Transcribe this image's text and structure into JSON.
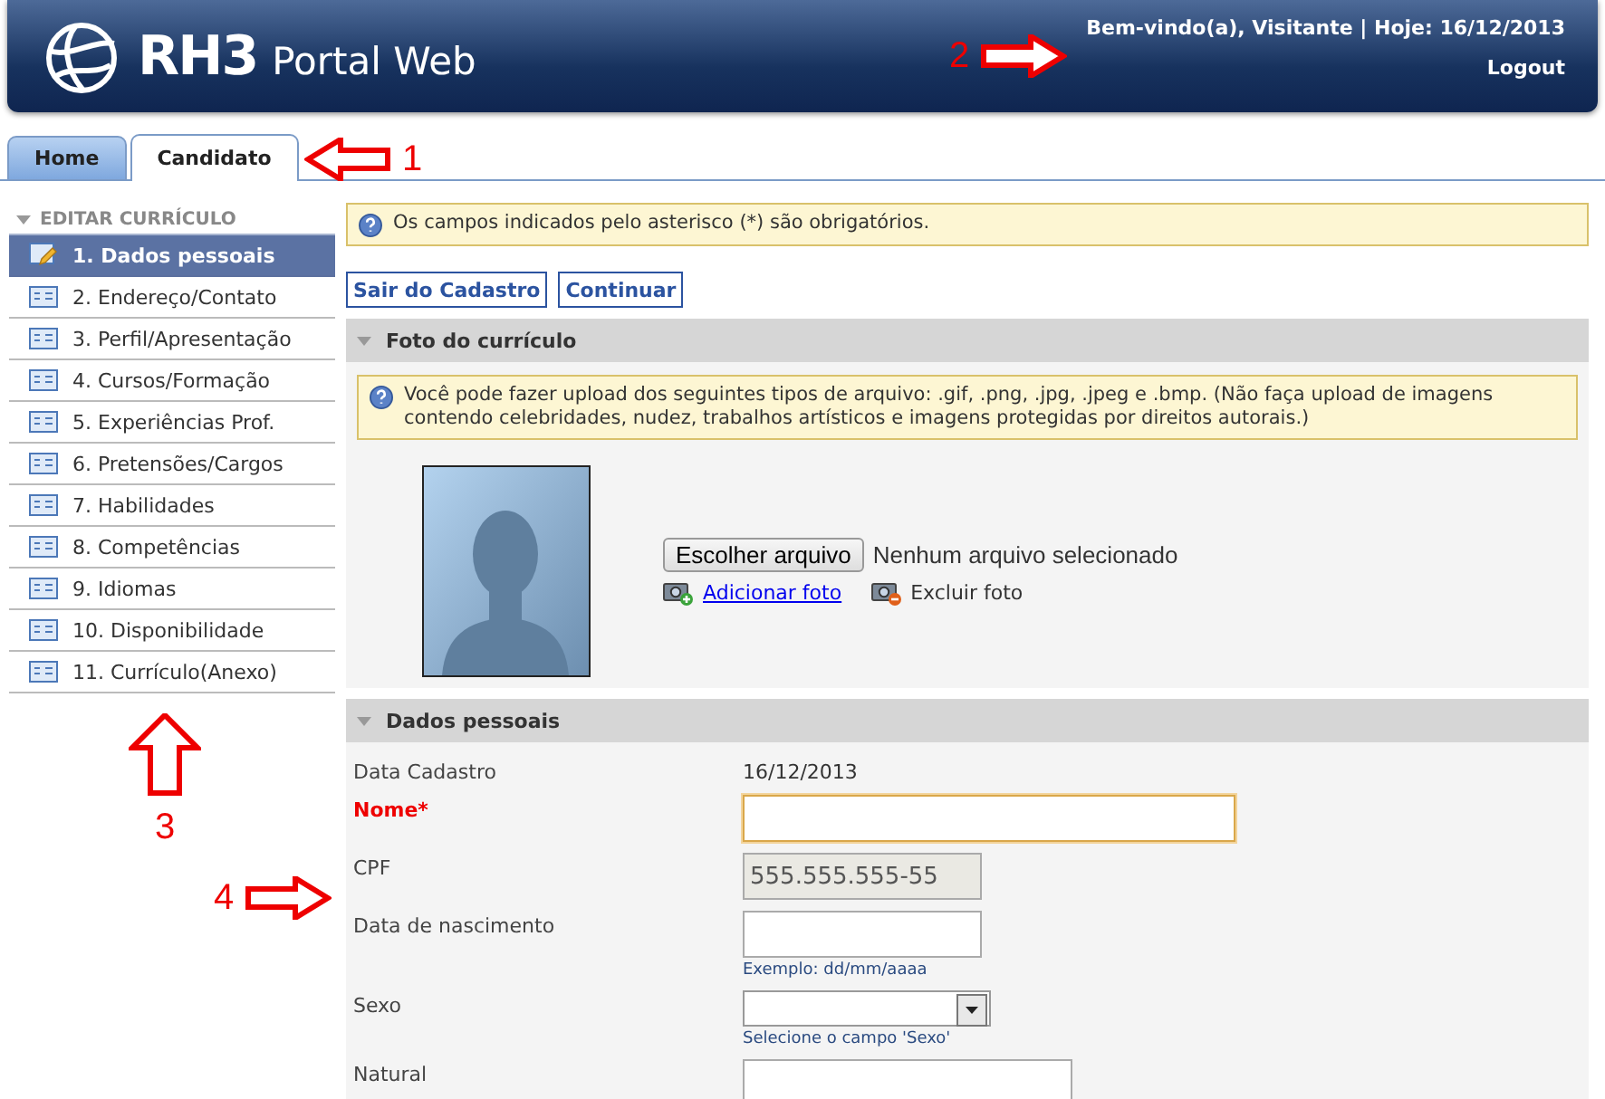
{
  "header": {
    "logo": "RH3",
    "product": "Portal Web",
    "welcome": "Bem-vindo(a), Visitante | Hoje: 16/12/2013",
    "logout": "Logout"
  },
  "tabs": [
    {
      "label": "Home",
      "selected": false
    },
    {
      "label": "Candidato",
      "selected": true
    }
  ],
  "sidebar": {
    "title": "EDITAR CURRÍCULO",
    "items": [
      {
        "label": "1. Dados pessoais",
        "selected": true
      },
      {
        "label": "2. Endereço/Contato",
        "selected": false
      },
      {
        "label": "3. Perfil/Apresentação",
        "selected": false
      },
      {
        "label": "4. Cursos/Formação",
        "selected": false
      },
      {
        "label": "5. Experiências Prof.",
        "selected": false
      },
      {
        "label": "6. Pretensões/Cargos",
        "selected": false
      },
      {
        "label": "7. Habilidades",
        "selected": false
      },
      {
        "label": "8. Competências",
        "selected": false
      },
      {
        "label": "9. Idiomas",
        "selected": false
      },
      {
        "label": "10. Disponibilidade",
        "selected": false
      },
      {
        "label": "11. Currículo(Anexo)",
        "selected": false
      }
    ]
  },
  "notice": "Os campos indicados pelo asterisco (*) são obrigatórios.",
  "buttons": [
    "Sair do Cadastro",
    "Continuar"
  ],
  "photo_section": {
    "title": "Foto do currículo",
    "notice": "Você pode fazer upload dos seguintes tipos de arquivo: .gif, .png, .jpg, .jpeg e .bmp. (Não faça upload de imagens contendo celebridades, nudez, trabalhos artísticos e imagens protegidas por direitos autorais.)",
    "choose_button": "Escolher arquivo",
    "no_file": "Nenhum arquivo selecionado",
    "add_photo": "Adicionar foto",
    "remove_photo": "Excluir foto"
  },
  "personal_section": {
    "title": "Dados pessoais",
    "fields": [
      {
        "label": "Data Cadastro",
        "kind": "text",
        "value": "16/12/2013",
        "required": false
      },
      {
        "label": "Nome*",
        "kind": "wide",
        "required": true,
        "focused": true
      },
      {
        "label": "CPF",
        "kind": "input",
        "value": "555.555.555-55",
        "disabled": true,
        "required": false
      },
      {
        "label": "Data de nascimento",
        "kind": "input",
        "hint": "Exemplo: dd/mm/aaaa",
        "required": false
      },
      {
        "label": "Sexo",
        "kind": "select",
        "hint": "Selecione o campo 'Sexo'",
        "required": false
      },
      {
        "label": "Natural",
        "kind": "medium",
        "required": false
      }
    ]
  },
  "callouts": [
    {
      "number": "1",
      "kind": "left"
    },
    {
      "number": "2",
      "kind": "right"
    },
    {
      "number": "3",
      "kind": "up"
    },
    {
      "number": "4",
      "kind": "right"
    }
  ]
}
